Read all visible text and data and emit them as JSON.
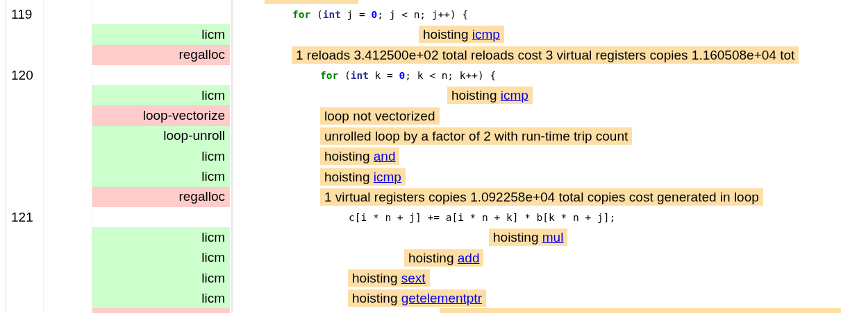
{
  "rows": [
    {
      "kind": "cut_remark"
    },
    {
      "kind": "source",
      "line": "119",
      "code": [
        {
          "kind": "keyword",
          "text": "for"
        },
        {
          "kind": "plain",
          "text": " ("
        },
        {
          "kind": "type",
          "text": "int"
        },
        {
          "kind": "plain",
          "text": " j = "
        },
        {
          "kind": "number",
          "text": "0"
        },
        {
          "kind": "plain",
          "text": "; j < n; j++) {"
        }
      ]
    },
    {
      "kind": "remark",
      "pass": "licm",
      "color": "#ccffcc",
      "text": "hoisting",
      "link": "icmp"
    },
    {
      "kind": "remark",
      "pass": "regalloc",
      "color": "#ffcccc",
      "text": "1 reloads 3.412500e+02 total reloads cost 3 virtual registers copies 1.160508e+04 tot"
    },
    {
      "kind": "source",
      "line": "120",
      "code": [
        {
          "kind": "keyword",
          "text": "for"
        },
        {
          "kind": "plain",
          "text": " ("
        },
        {
          "kind": "type",
          "text": "int"
        },
        {
          "kind": "plain",
          "text": " k = "
        },
        {
          "kind": "number",
          "text": "0"
        },
        {
          "kind": "plain",
          "text": "; k < n; k++) {"
        }
      ]
    },
    {
      "kind": "remark",
      "pass": "licm",
      "color": "#ccffcc",
      "text": "hoisting",
      "link": "icmp"
    },
    {
      "kind": "remark",
      "pass": "loop-vectorize",
      "color": "#ffcccc",
      "text": "loop not vectorized"
    },
    {
      "kind": "remark",
      "pass": "loop-unroll",
      "color": "#ccffcc",
      "text": "unrolled loop by a factor of 2 with run-time trip count"
    },
    {
      "kind": "remark",
      "pass": "licm",
      "color": "#ccffcc",
      "text": "hoisting",
      "link": "and"
    },
    {
      "kind": "remark",
      "pass": "licm",
      "color": "#ccffcc",
      "text": "hoisting",
      "link": "icmp"
    },
    {
      "kind": "remark",
      "pass": "regalloc",
      "color": "#ffcccc",
      "text": "1 virtual registers copies 1.092258e+04 total copies cost generated in loop"
    },
    {
      "kind": "source",
      "line": "121",
      "code": [
        {
          "kind": "plain",
          "text": "c[i * n + j] += a[i * n + k] * b[k * n + j];"
        }
      ]
    },
    {
      "kind": "remark",
      "pass": "licm",
      "color": "#ccffcc",
      "text": "hoisting",
      "link": "mul"
    },
    {
      "kind": "remark",
      "pass": "licm",
      "color": "#ccffcc",
      "text": "hoisting",
      "link": "add"
    },
    {
      "kind": "remark",
      "pass": "licm",
      "color": "#ccffcc",
      "text": "hoisting",
      "link": "sext"
    },
    {
      "kind": "remark",
      "pass": "licm",
      "color": "#ccffcc",
      "text": "hoisting",
      "link": "getelementptr"
    },
    {
      "kind": "cut_remark",
      "color": "#ffcccc"
    }
  ]
}
